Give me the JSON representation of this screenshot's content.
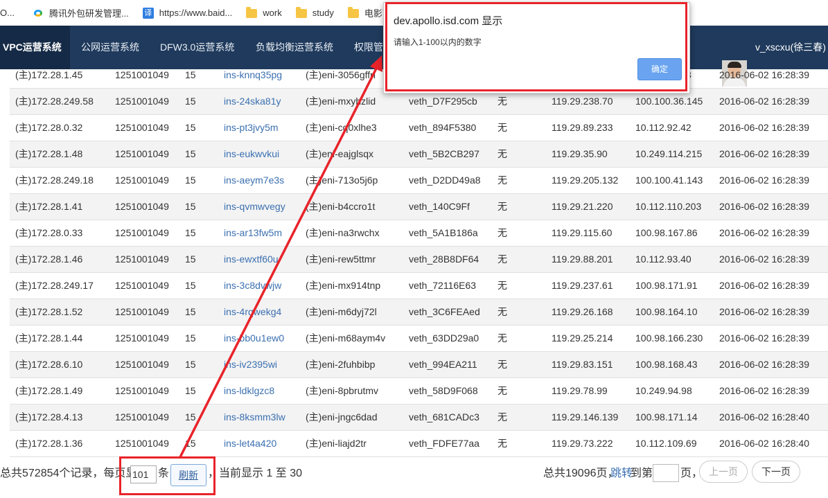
{
  "bookmarks": [
    {
      "label": "O...",
      "icon": "generic-icon"
    },
    {
      "label": "腾讯外包研发管理...",
      "icon": "tencent-icon"
    },
    {
      "label": "https://www.baid...",
      "icon": "translate-icon"
    },
    {
      "label": "work",
      "icon": "folder-icon"
    },
    {
      "label": "study",
      "icon": "folder-icon"
    },
    {
      "label": "电影下",
      "icon": "folder-icon"
    }
  ],
  "nav": {
    "items": [
      "VPC运营系统",
      "公网运营系统",
      "DFW3.0运营系统",
      "负载均衡运营系统",
      "权限管"
    ],
    "user": "v_xscxu(徐三春)"
  },
  "dialog": {
    "title": "dev.apollo.isd.com 显示",
    "message": "请输入1-100以内的数字",
    "ok_label": "确定"
  },
  "rows": [
    [
      "(主)172.28.1.45",
      "1251001049",
      "15",
      "ins-knnq35pg",
      "(主)eni-3056gffn",
      "",
      "",
      "",
      "",
      "3",
      "2016-06-02 16:28:39"
    ],
    [
      "(主)172.28.249.58",
      "1251001049",
      "15",
      "ins-24ska81y",
      "(主)eni-mxyhzlid",
      "veth_D7F295cb",
      "无",
      "119.29.238.70",
      "100.100.36.145",
      "2016-06-02 16:28:39"
    ],
    [
      "(主)172.28.0.32",
      "1251001049",
      "15",
      "ins-pt3jvy5m",
      "(主)eni-cq0xlhe3",
      "veth_894F5380",
      "无",
      "119.29.89.233",
      "10.112.92.42",
      "2016-06-02 16:28:39"
    ],
    [
      "(主)172.28.1.48",
      "1251001049",
      "15",
      "ins-eukwvkui",
      "(主)eni-eajglsqx",
      "veth_5B2CB297",
      "无",
      "119.29.35.90",
      "10.249.114.215",
      "2016-06-02 16:28:39"
    ],
    [
      "(主)172.28.249.18",
      "1251001049",
      "15",
      "ins-aeym7e3s",
      "(主)eni-713o5j6p",
      "veth_D2DD49a8",
      "无",
      "119.29.205.132",
      "100.100.41.143",
      "2016-06-02 16:28:39"
    ],
    [
      "(主)172.28.1.41",
      "1251001049",
      "15",
      "ins-qvmwvegy",
      "(主)eni-b4ccro1t",
      "veth_140C9Ff",
      "无",
      "119.29.21.220",
      "10.112.110.203",
      "2016-06-02 16:28:39"
    ],
    [
      "(主)172.28.0.33",
      "1251001049",
      "15",
      "ins-ar13fw5m",
      "(主)eni-na3rwchx",
      "veth_5A1B186a",
      "无",
      "119.29.115.60",
      "100.98.167.86",
      "2016-06-02 16:28:39"
    ],
    [
      "(主)172.28.1.46",
      "1251001049",
      "15",
      "ins-ewxtf60u",
      "(主)eni-rew5ttmr",
      "veth_28B8DF64",
      "无",
      "119.29.88.201",
      "10.112.93.40",
      "2016-06-02 16:28:39"
    ],
    [
      "(主)172.28.249.17",
      "1251001049",
      "15",
      "ins-3c8dvwjw",
      "(主)eni-mx914tnp",
      "veth_72116E63",
      "无",
      "119.29.237.61",
      "100.98.171.91",
      "2016-06-02 16:28:39"
    ],
    [
      "(主)172.28.1.52",
      "1251001049",
      "15",
      "ins-4rqwekg4",
      "(主)eni-m6dyj72l",
      "veth_3C6FEAed",
      "无",
      "119.29.26.168",
      "100.98.164.10",
      "2016-06-02 16:28:39"
    ],
    [
      "(主)172.28.1.44",
      "1251001049",
      "15",
      "ins-bb0u1ew0",
      "(主)eni-m68aym4v",
      "veth_63DD29a0",
      "无",
      "119.29.25.214",
      "100.98.166.230",
      "2016-06-02 16:28:39"
    ],
    [
      "(主)172.28.6.10",
      "1251001049",
      "15",
      "ins-iv2395wi",
      "(主)eni-2fuhbibp",
      "veth_994EA211",
      "无",
      "119.29.83.151",
      "100.98.168.43",
      "2016-06-02 16:28:39"
    ],
    [
      "(主)172.28.1.49",
      "1251001049",
      "15",
      "ins-ldklgzc8",
      "(主)eni-8pbrutmv",
      "veth_58D9F068",
      "无",
      "119.29.78.99",
      "10.249.94.98",
      "2016-06-02 16:28:39"
    ],
    [
      "(主)172.28.4.13",
      "1251001049",
      "15",
      "ins-8ksmm3lw",
      "(主)eni-jngc6dad",
      "veth_681CADc3",
      "无",
      "119.29.146.139",
      "100.98.171.14",
      "2016-06-02 16:28:40"
    ],
    [
      "(主)172.28.1.36",
      "1251001049",
      "15",
      "ins-let4a420",
      "(主)eni-liajd2tr",
      "veth_FDFE77aa",
      "无",
      "119.29.73.222",
      "10.112.109.69",
      "2016-06-02 16:28:40"
    ]
  ],
  "footer": {
    "total_records": "总共572854个记录，每页显示",
    "page_size_value": "101",
    "unit": "条",
    "refresh_label": "刷新",
    "showing": "，当前显示 1 至 30",
    "total_pages": "总共19096页，",
    "jump_label": "跳转",
    "to_page": "到第",
    "page_unit": "页，",
    "prev_label": "上一页",
    "next_label": "下一页"
  },
  "colors": {
    "nav_bg": "#1f3a5c",
    "annotation_red": "#e8232a",
    "link": "#3a6fb0",
    "dialog_button": "#6aa4f0"
  }
}
